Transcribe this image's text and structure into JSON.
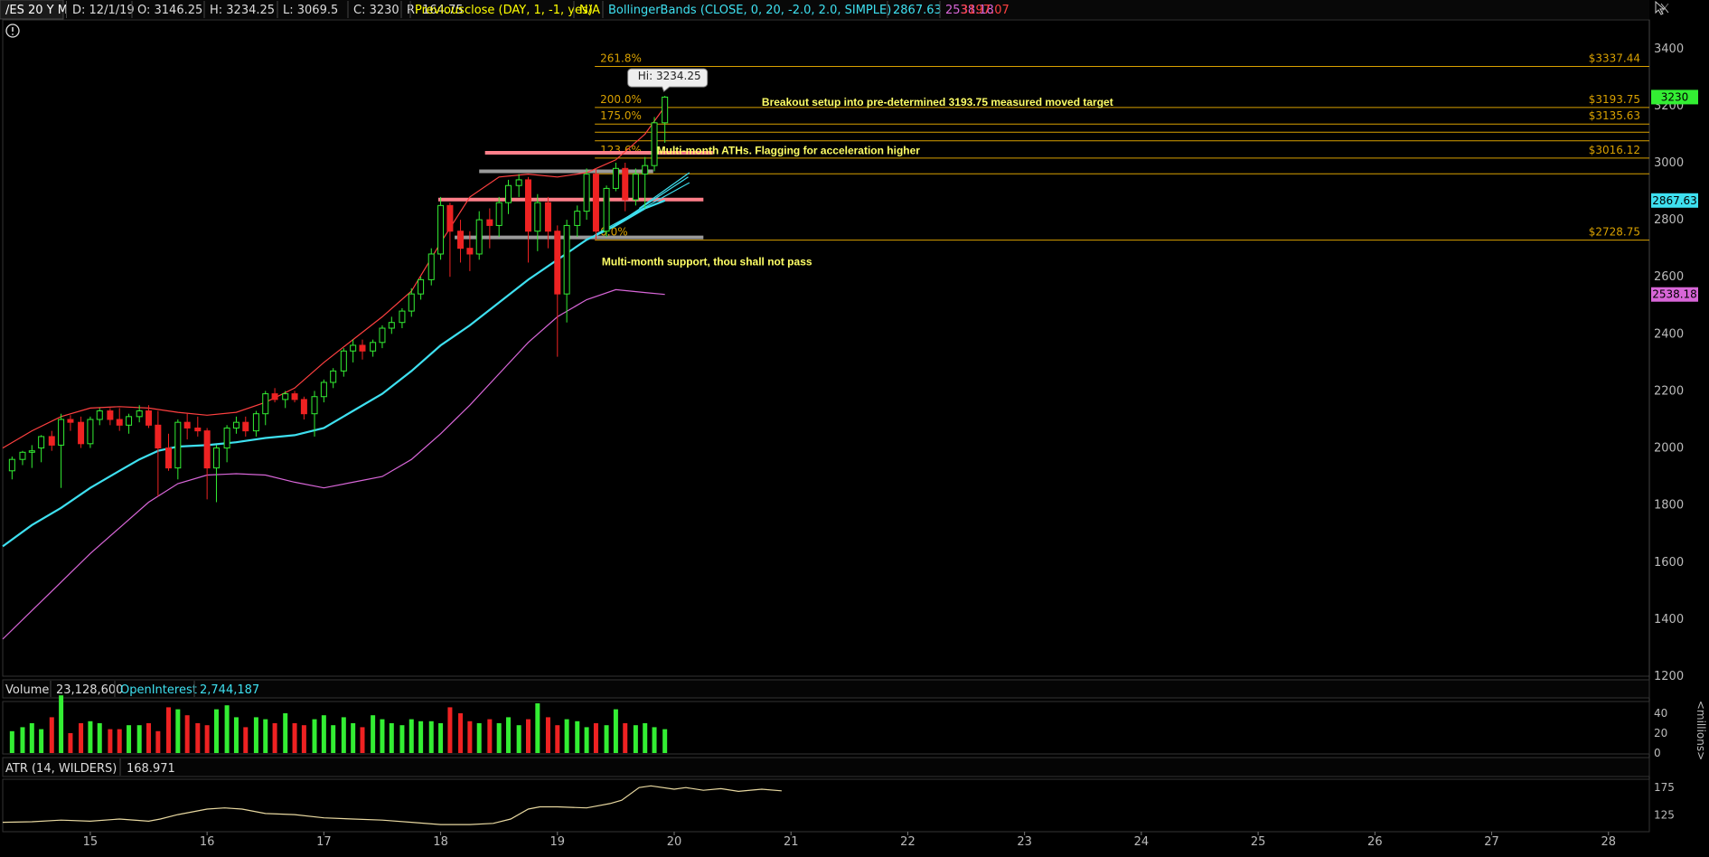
{
  "header": {
    "symbol": "/ES 20 Y M",
    "date": "D: 12/1/19",
    "open": "O: 3146.25",
    "high": "H: 3234.25",
    "low": "L: 3069.5",
    "close": "C: 3230",
    "range": "R: 164.75",
    "prev_close_study": "Previousclose (DAY, 1, -1, yes)",
    "prev_close_value": "N/A",
    "bb_study": "BollingerBands (CLOSE, 0, 20, -2.0, 2.0, SIMPLE)",
    "bb_mid": "2867.63",
    "bb_lower": "2538.18",
    "bb_upper": "3197.07"
  },
  "colors": {
    "bb_mid": "#3ee0f0",
    "bb_lower": "#d866d8",
    "bb_upper": "#ff4040",
    "fib": "#d8a000",
    "annotation": "#ffff66",
    "up": "#33ee33",
    "down": "#ee2222",
    "atr": "#e8d8a0"
  },
  "icons": {
    "alert": "exclamation-circle-icon",
    "settings": "cursor-tools-icon"
  },
  "chart_data": [
    {
      "type": "candlestick",
      "title": "",
      "y_ticks": [
        "3400",
        "3200",
        "3000",
        "2800",
        "2600",
        "2400",
        "2200",
        "2000",
        "1800",
        "1600",
        "1400",
        "1200"
      ],
      "x_ticks": [
        "15",
        "16",
        "17",
        "18",
        "19",
        "20",
        "21",
        "22",
        "23",
        "24",
        "25",
        "26",
        "27",
        "28"
      ],
      "xlim": [
        14.25,
        28.35
      ],
      "ylim": [
        1200,
        3450
      ],
      "hi_label": "Hi: 3234.25",
      "price_badges": [
        {
          "label": "3230",
          "value": 3230,
          "color": "#33ee33"
        },
        {
          "label": "2867.63",
          "value": 2867.63,
          "color": "#3ee0f0"
        },
        {
          "label": "2538.18",
          "value": 2538.18,
          "color": "#d866d8"
        }
      ],
      "fib_levels": [
        {
          "pct": "261.8%",
          "price": "$3337.44",
          "value": 3337.44
        },
        {
          "pct": "200.0%",
          "price": "$3193.75",
          "value": 3193.75
        },
        {
          "pct": "175.0%",
          "price": "$3135.63",
          "value": 3135.63
        },
        {
          "pct": "",
          "price": "",
          "value": 3107
        },
        {
          "pct": "",
          "price": "",
          "value": 3077
        },
        {
          "pct": "123.6%",
          "price": "$3016.12",
          "value": 3016.12
        },
        {
          "pct": "",
          "price": "",
          "value": 2961
        },
        {
          "pct": "0.0%",
          "price": "$2728.75",
          "value": 2728.75
        }
      ],
      "annotations": [
        {
          "text": "Breakout setup  into pre-determined 3193.75 measured moved target",
          "x": 20.75,
          "y": 3199
        },
        {
          "text": "Multi-month ATHs. Flagging for acceleration higher",
          "x": 19.85,
          "y": 3030
        },
        {
          "text": "Multi-month support, thou shall not pass",
          "x": 19.38,
          "y": 2640
        }
      ],
      "zones": [
        {
          "x1": 17.98,
          "x2": 20.25,
          "value": 2871,
          "color": "#ff7f8a"
        },
        {
          "x1": 18.38,
          "x2": 20.33,
          "value": 3035,
          "color": "#ff7f8a"
        },
        {
          "x1": 18.33,
          "x2": 19.82,
          "value": 2970,
          "color": "#9a9a9a"
        },
        {
          "x1": 18.12,
          "x2": 20.25,
          "value": 2738,
          "color": "#9a9a9a"
        }
      ],
      "trend_lines": [
        {
          "x1": 19.32,
          "y1": 2747,
          "x2": 20.13,
          "y2": 2930
        },
        {
          "x1": 19.45,
          "y1": 2770,
          "x2": 20.12,
          "y2": 2950
        },
        {
          "x1": 19.7,
          "y1": 2840,
          "x2": 20.13,
          "y2": 2965
        }
      ],
      "candles": [
        [
          14.33,
          1920,
          1970,
          1890,
          1960
        ],
        [
          14.42,
          1960,
          1990,
          1940,
          1985
        ],
        [
          14.5,
          1985,
          2010,
          1930,
          1990
        ],
        [
          14.58,
          2000,
          2045,
          1950,
          2040
        ],
        [
          14.67,
          2040,
          2060,
          1990,
          2010
        ],
        [
          14.75,
          2010,
          2120,
          1860,
          2100
        ],
        [
          14.83,
          2100,
          2115,
          2060,
          2090
        ],
        [
          14.92,
          2090,
          2110,
          2000,
          2015
        ],
        [
          15.0,
          2015,
          2110,
          2000,
          2100
        ],
        [
          15.08,
          2100,
          2140,
          2080,
          2130
        ],
        [
          15.17,
          2130,
          2140,
          2080,
          2100
        ],
        [
          15.25,
          2100,
          2140,
          2060,
          2080
        ],
        [
          15.33,
          2080,
          2120,
          2050,
          2110
        ],
        [
          15.42,
          2110,
          2150,
          2090,
          2130
        ],
        [
          15.5,
          2130,
          2150,
          2070,
          2080
        ],
        [
          15.58,
          2080,
          2130,
          1830,
          2000
        ],
        [
          15.67,
          2000,
          2050,
          1920,
          1930
        ],
        [
          15.75,
          1930,
          2100,
          1890,
          2090
        ],
        [
          15.83,
          2090,
          2120,
          2030,
          2070
        ],
        [
          15.92,
          2070,
          2110,
          2040,
          2060
        ],
        [
          16.0,
          2060,
          2070,
          1820,
          1930
        ],
        [
          16.08,
          1930,
          2010,
          1810,
          2000
        ],
        [
          16.17,
          2000,
          2080,
          1950,
          2070
        ],
        [
          16.25,
          2070,
          2110,
          2050,
          2090
        ],
        [
          16.33,
          2090,
          2110,
          2040,
          2060
        ],
        [
          16.42,
          2060,
          2130,
          2040,
          2120
        ],
        [
          16.5,
          2120,
          2200,
          2080,
          2190
        ],
        [
          16.58,
          2190,
          2210,
          2160,
          2170
        ],
        [
          16.67,
          2170,
          2200,
          2140,
          2190
        ],
        [
          16.75,
          2190,
          2200,
          2160,
          2170
        ],
        [
          16.83,
          2170,
          2180,
          2100,
          2120
        ],
        [
          16.92,
          2120,
          2200,
          2040,
          2180
        ],
        [
          17.0,
          2180,
          2240,
          2160,
          2230
        ],
        [
          17.08,
          2230,
          2280,
          2210,
          2270
        ],
        [
          17.17,
          2270,
          2350,
          2250,
          2340
        ],
        [
          17.25,
          2340,
          2380,
          2300,
          2360
        ],
        [
          17.33,
          2360,
          2380,
          2310,
          2340
        ],
        [
          17.42,
          2340,
          2380,
          2320,
          2370
        ],
        [
          17.5,
          2370,
          2430,
          2350,
          2420
        ],
        [
          17.58,
          2420,
          2460,
          2400,
          2440
        ],
        [
          17.67,
          2440,
          2490,
          2420,
          2480
        ],
        [
          17.75,
          2480,
          2560,
          2460,
          2540
        ],
        [
          17.83,
          2540,
          2600,
          2520,
          2590
        ],
        [
          17.92,
          2590,
          2700,
          2570,
          2680
        ],
        [
          18.0,
          2680,
          2880,
          2660,
          2850
        ],
        [
          18.08,
          2850,
          2860,
          2600,
          2760
        ],
        [
          18.17,
          2760,
          2800,
          2650,
          2700
        ],
        [
          18.25,
          2700,
          2760,
          2620,
          2680
        ],
        [
          18.33,
          2680,
          2830,
          2660,
          2800
        ],
        [
          18.42,
          2800,
          2840,
          2700,
          2780
        ],
        [
          18.5,
          2780,
          2880,
          2740,
          2860
        ],
        [
          18.58,
          2860,
          2940,
          2820,
          2920
        ],
        [
          18.67,
          2920,
          2960,
          2880,
          2940
        ],
        [
          18.75,
          2940,
          2950,
          2650,
          2760
        ],
        [
          18.83,
          2760,
          2890,
          2690,
          2860
        ],
        [
          18.92,
          2860,
          2880,
          2700,
          2760
        ],
        [
          19.0,
          2760,
          2780,
          2320,
          2540
        ],
        [
          19.08,
          2540,
          2800,
          2440,
          2780
        ],
        [
          19.17,
          2780,
          2850,
          2740,
          2830
        ],
        [
          19.25,
          2830,
          2980,
          2800,
          2960
        ],
        [
          19.33,
          2960,
          2980,
          2730,
          2760
        ],
        [
          19.42,
          2760,
          2920,
          2740,
          2910
        ],
        [
          19.5,
          2910,
          3000,
          2900,
          2980
        ],
        [
          19.58,
          2980,
          3000,
          2830,
          2870
        ],
        [
          19.67,
          2870,
          2980,
          2850,
          2960
        ],
        [
          19.75,
          2960,
          3020,
          2840,
          2990
        ],
        [
          19.83,
          2990,
          3160,
          2970,
          3140
        ],
        [
          19.92,
          3140,
          3234.25,
          3070,
          3230
        ]
      ],
      "bb_mid_line": [
        [
          14.25,
          1655
        ],
        [
          14.5,
          1730
        ],
        [
          14.75,
          1790
        ],
        [
          15.0,
          1860
        ],
        [
          15.25,
          1920
        ],
        [
          15.42,
          1960
        ],
        [
          15.58,
          1990
        ],
        [
          15.75,
          2005
        ],
        [
          16.0,
          2010
        ],
        [
          16.25,
          2020
        ],
        [
          16.5,
          2035
        ],
        [
          16.75,
          2045
        ],
        [
          17.0,
          2070
        ],
        [
          17.25,
          2130
        ],
        [
          17.5,
          2190
        ],
        [
          17.75,
          2270
        ],
        [
          18.0,
          2360
        ],
        [
          18.25,
          2430
        ],
        [
          18.5,
          2510
        ],
        [
          18.75,
          2590
        ],
        [
          19.0,
          2660
        ],
        [
          19.25,
          2730
        ],
        [
          19.5,
          2780
        ],
        [
          19.75,
          2840
        ],
        [
          19.92,
          2867.63
        ]
      ],
      "bb_upper_line": [
        [
          14.25,
          2000
        ],
        [
          14.5,
          2060
        ],
        [
          14.75,
          2110
        ],
        [
          15.0,
          2140
        ],
        [
          15.25,
          2145
        ],
        [
          15.5,
          2140
        ],
        [
          15.75,
          2125
        ],
        [
          16.0,
          2115
        ],
        [
          16.25,
          2125
        ],
        [
          16.5,
          2160
        ],
        [
          16.75,
          2210
        ],
        [
          17.0,
          2300
        ],
        [
          17.25,
          2380
        ],
        [
          17.5,
          2460
        ],
        [
          17.75,
          2550
        ],
        [
          18.0,
          2720
        ],
        [
          18.25,
          2880
        ],
        [
          18.5,
          2950
        ],
        [
          18.75,
          2960
        ],
        [
          19.0,
          2950
        ],
        [
          19.25,
          2965
        ],
        [
          19.5,
          3010
        ],
        [
          19.75,
          3100
        ],
        [
          19.92,
          3197.07
        ]
      ],
      "bb_lower_line": [
        [
          14.25,
          1330
        ],
        [
          14.5,
          1430
        ],
        [
          14.75,
          1530
        ],
        [
          15.0,
          1630
        ],
        [
          15.25,
          1720
        ],
        [
          15.5,
          1810
        ],
        [
          15.75,
          1875
        ],
        [
          16.0,
          1905
        ],
        [
          16.25,
          1910
        ],
        [
          16.5,
          1905
        ],
        [
          16.75,
          1880
        ],
        [
          17.0,
          1860
        ],
        [
          17.25,
          1880
        ],
        [
          17.5,
          1900
        ],
        [
          17.75,
          1960
        ],
        [
          18.0,
          2050
        ],
        [
          18.25,
          2150
        ],
        [
          18.5,
          2260
        ],
        [
          18.75,
          2370
        ],
        [
          19.0,
          2460
        ],
        [
          19.25,
          2520
        ],
        [
          19.5,
          2555
        ],
        [
          19.75,
          2545
        ],
        [
          19.92,
          2538.18
        ]
      ]
    },
    {
      "type": "bar",
      "title": "Volume",
      "label": "Volume",
      "value": "23,128,600",
      "oi_label": "OpenInterest",
      "oi_value": "2,744,187",
      "y_ticks": [
        "40",
        "20",
        "0"
      ],
      "axis_unit": "<millions>",
      "ylim": [
        0,
        50
      ],
      "volumes": [
        22,
        26,
        30,
        24,
        36,
        58,
        20,
        30,
        32,
        30,
        24,
        24,
        28,
        28,
        30,
        22,
        46,
        44,
        38,
        30,
        28,
        44,
        48,
        36,
        26,
        36,
        34,
        30,
        40,
        30,
        28,
        34,
        38,
        28,
        36,
        30,
        26,
        38,
        34,
        30,
        28,
        34,
        32,
        32,
        30,
        46,
        40,
        32,
        30,
        34,
        30,
        36,
        28,
        34,
        50,
        36,
        28,
        34,
        32,
        26,
        30,
        28,
        44,
        30,
        28,
        30,
        26,
        24
      ]
    },
    {
      "type": "line",
      "title": "ATR (14, WILDERS)",
      "label": "ATR (14, WILDERS)",
      "value": "168.971",
      "y_ticks": [
        "175",
        "125"
      ],
      "ylim": [
        95,
        190
      ],
      "points": [
        [
          14.25,
          112
        ],
        [
          14.5,
          113
        ],
        [
          14.75,
          116
        ],
        [
          15.0,
          114
        ],
        [
          15.25,
          118
        ],
        [
          15.5,
          114
        ],
        [
          15.6,
          118
        ],
        [
          15.75,
          126
        ],
        [
          16.0,
          136
        ],
        [
          16.15,
          138
        ],
        [
          16.3,
          136
        ],
        [
          16.5,
          128
        ],
        [
          16.75,
          126
        ],
        [
          17.0,
          120
        ],
        [
          17.25,
          118
        ],
        [
          17.5,
          116
        ],
        [
          17.75,
          112
        ],
        [
          18.0,
          108
        ],
        [
          18.25,
          108
        ],
        [
          18.45,
          110
        ],
        [
          18.6,
          118
        ],
        [
          18.75,
          136
        ],
        [
          18.85,
          140
        ],
        [
          19.0,
          140
        ],
        [
          19.25,
          138
        ],
        [
          19.45,
          146
        ],
        [
          19.55,
          152
        ],
        [
          19.7,
          175
        ],
        [
          19.8,
          178
        ],
        [
          20.0,
          172
        ],
        [
          20.1,
          175
        ],
        [
          20.25,
          170
        ],
        [
          20.4,
          173
        ],
        [
          20.55,
          168
        ],
        [
          20.75,
          172
        ],
        [
          20.92,
          169
        ]
      ]
    }
  ]
}
